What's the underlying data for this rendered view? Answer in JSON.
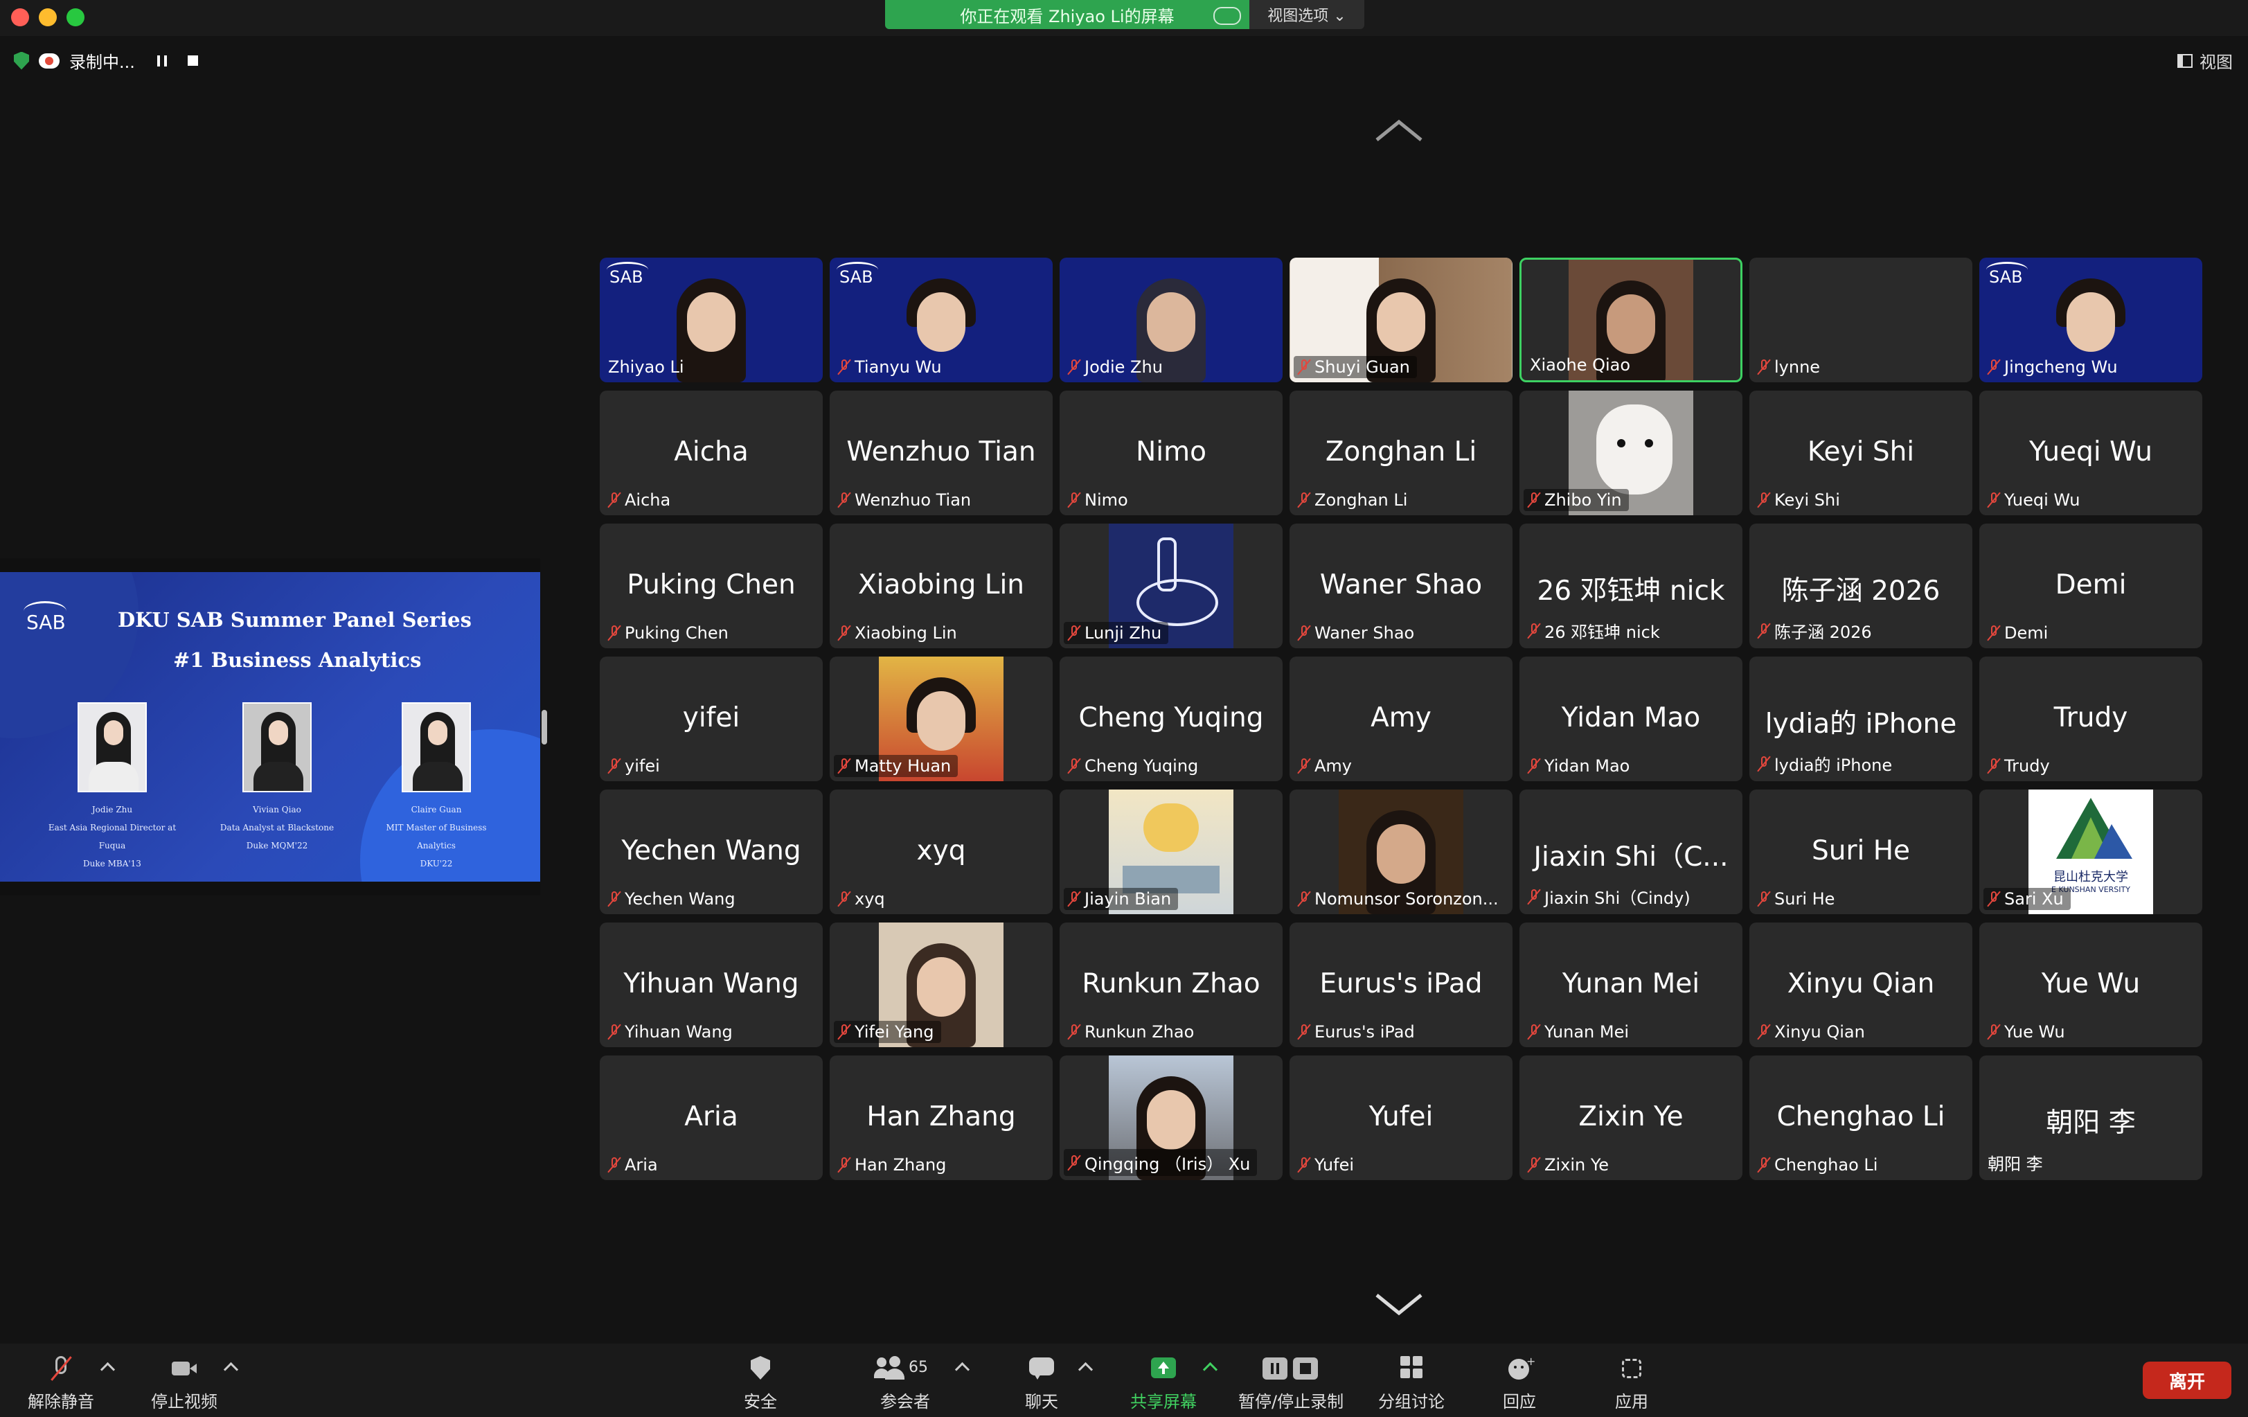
{
  "banner": {
    "text": "你正在观看 Zhiyao Li的屏幕",
    "view_options": "视图选项 ⌄"
  },
  "top_left": {
    "recording": "录制中..."
  },
  "top_right": {
    "view": "视图"
  },
  "slide": {
    "logo": "SAB",
    "title": "DKU SAB Summer Panel Series",
    "subtitle": "#1 Business Analytics",
    "speakers": [
      {
        "name": "Jodie Zhu",
        "line1": "East Asia Regional Director at Fuqua",
        "line2": "Duke MBA'13"
      },
      {
        "name": "Vivian Qiao",
        "line1": "Data Analyst at Blackstone",
        "line2": "Duke MQM'22"
      },
      {
        "name": "Claire Guan",
        "line1": "MIT Master of Business Analytics",
        "line2": "DKU'22"
      }
    ]
  },
  "participants": [
    {
      "big": "",
      "label": "Zhiyao Li"
    },
    {
      "big": "",
      "label": "Tianyu Wu"
    },
    {
      "big": "",
      "label": "Jodie Zhu"
    },
    {
      "big": "",
      "label": "Shuyi Guan"
    },
    {
      "big": "",
      "label": "Xiaohe Qiao"
    },
    {
      "big": "",
      "label": "lynne"
    },
    {
      "big": "",
      "label": "Jingcheng Wu"
    },
    {
      "big": "Aicha",
      "label": "Aicha"
    },
    {
      "big": "Wenzhuo Tian",
      "label": "Wenzhuo Tian"
    },
    {
      "big": "Nimo",
      "label": "Nimo"
    },
    {
      "big": "Zonghan Li",
      "label": "Zonghan Li"
    },
    {
      "big": "",
      "label": "Zhibo Yin"
    },
    {
      "big": "Keyi Shi",
      "label": "Keyi Shi"
    },
    {
      "big": "Yueqi Wu",
      "label": "Yueqi Wu"
    },
    {
      "big": "Puking Chen",
      "label": "Puking Chen"
    },
    {
      "big": "Xiaobing Lin",
      "label": "Xiaobing Lin"
    },
    {
      "big": "",
      "label": "Lunji Zhu"
    },
    {
      "big": "Waner Shao",
      "label": "Waner Shao"
    },
    {
      "big": "26 邓钰坤 nick",
      "label": "26 邓钰坤 nick"
    },
    {
      "big": "陈子涵 2026",
      "label": "陈子涵 2026"
    },
    {
      "big": "Demi",
      "label": "Demi"
    },
    {
      "big": "yifei",
      "label": "yifei"
    },
    {
      "big": "",
      "label": "Matty Huan"
    },
    {
      "big": "Cheng Yuqing",
      "label": "Cheng Yuqing"
    },
    {
      "big": "Amy",
      "label": "Amy"
    },
    {
      "big": "Yidan Mao",
      "label": "Yidan Mao"
    },
    {
      "big": "lydia的 iPhone",
      "label": "lydia的 iPhone"
    },
    {
      "big": "Trudy",
      "label": "Trudy"
    },
    {
      "big": "Yechen Wang",
      "label": "Yechen Wang"
    },
    {
      "big": "xyq",
      "label": "xyq"
    },
    {
      "big": "",
      "label": "Jiayin Bian"
    },
    {
      "big": "",
      "label": "Nomunsor Soronzon..."
    },
    {
      "big": "Jiaxin Shi（C...",
      "label": "Jiaxin Shi（Cindy)"
    },
    {
      "big": "Suri He",
      "label": "Suri He"
    },
    {
      "big": "",
      "label": "Sari Xu",
      "logo_text": "昆山杜克大学",
      "logo_sub": "E KUNSHAN VERSITY"
    },
    {
      "big": "Yihuan Wang",
      "label": "Yihuan Wang"
    },
    {
      "big": "",
      "label": "Yifei Yang"
    },
    {
      "big": "Runkun Zhao",
      "label": "Runkun Zhao"
    },
    {
      "big": "Eurus's iPad",
      "label": "Eurus's iPad"
    },
    {
      "big": "Yunan Mei",
      "label": "Yunan Mei"
    },
    {
      "big": "Xinyu Qian",
      "label": "Xinyu Qian"
    },
    {
      "big": "Yue Wu",
      "label": "Yue Wu"
    },
    {
      "big": "Aria",
      "label": "Aria"
    },
    {
      "big": "Han Zhang",
      "label": "Han Zhang"
    },
    {
      "big": "",
      "label": "Qingqing （Iris） Xu"
    },
    {
      "big": "Yufei",
      "label": "Yufei"
    },
    {
      "big": "Zixin Ye",
      "label": "Zixin Ye"
    },
    {
      "big": "Chenghao Li",
      "label": "Chenghao Li"
    },
    {
      "big": "朝阳 李",
      "label": "朝阳 李"
    }
  ],
  "toolbar": {
    "unmute": "解除静音",
    "stop_video": "停止视频",
    "security": "安全",
    "participants": "参会者",
    "participants_count": "65",
    "chat": "聊天",
    "share": "共享屏幕",
    "pause_record": "暂停/停止录制",
    "breakout": "分组讨论",
    "reactions": "回应",
    "apps": "应用",
    "leave": "离开"
  },
  "colors": {
    "green": "#2ea44f",
    "leave_red": "#c5281c",
    "tile_bg": "#2a2a2a",
    "video_blue": "#13207e"
  }
}
